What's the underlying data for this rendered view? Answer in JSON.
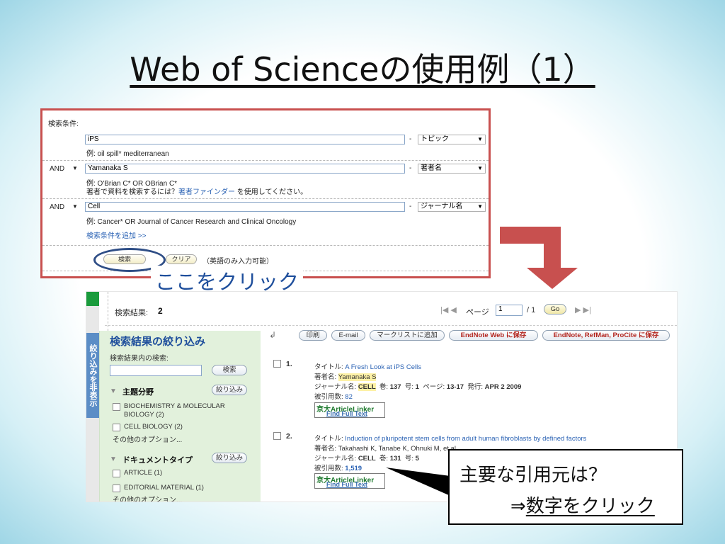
{
  "slide": {
    "title": "Web of Scienceの使用例（1）",
    "click_here": "ここをクリック",
    "callout_line1": "主要な引用元は？",
    "callout_arrow": "⇒",
    "callout_line2": "数字をクリック"
  },
  "search_form": {
    "header": "検索条件:",
    "rows": [
      {
        "op": "",
        "value": "iPS",
        "example": "例: oil spill* mediterranean",
        "field": "トピック"
      },
      {
        "op": "AND",
        "value": "Yamanaka S",
        "example": "例: O'Brian C* OR OBrian C*",
        "field": "著者名",
        "hint_pre": "著者で資料を検索するには？",
        "hint_link": "著者ファインダー",
        "hint_post": " を使用してください。"
      },
      {
        "op": "AND",
        "value": "Cell",
        "example": "例: Cancer* OR Journal of Cancer Research and Clinical Oncology",
        "field": "ジャーナル名"
      }
    ],
    "add_link": "検索条件を追加 >>",
    "search_btn": "検索",
    "clear_btn": "クリア",
    "english_note": "（英語のみ入力可能）",
    "dash": "-"
  },
  "results": {
    "count_label": "検索結果:",
    "count": "2",
    "page_label": "ページ",
    "page_value": "1",
    "page_total": "/ 1",
    "go_btn": "Go",
    "prev_icons": "|◀ ◀",
    "next_icons": "▶ ▶|",
    "toolbar": [
      "印刷",
      "E-mail",
      "マークリストに追加",
      "EndNote Web に保存",
      "EndNote, RefMan, ProCite に保存"
    ],
    "sidebar_tab": "絞り込みを非表示",
    "sidebar": {
      "title": "検索結果の絞り込み",
      "within_label": "検索結果内の検索:",
      "within_btn": "検索",
      "section1": "主題分野",
      "section1_btn": "絞り込み",
      "s1_items": [
        "BIOCHEMISTRY & MOLECULAR",
        "BIOLOGY (2)",
        "CELL BIOLOGY (2)"
      ],
      "more1": "その他のオプション...",
      "section2": "ドキュメントタイプ",
      "section2_btn": "絞り込み",
      "s2_items": [
        "ARTICLE (1)",
        "EDITORIAL MATERIAL (1)"
      ],
      "more2": "その他のオプション..."
    },
    "items": [
      {
        "num": "1.",
        "title_label": "タイトル:",
        "title": "A Fresh Look at iPS Cells",
        "author_label": "著者名:",
        "authors": "Yamanaka S",
        "journal_label": "ジャーナル名:",
        "journal": "CELL",
        "vol_label": "巻:",
        "vol": "137",
        "issue_label": "号:",
        "issue": "1",
        "page_label": "ページ:",
        "pages": "13-17",
        "pub_label": "発行:",
        "pub": "APR 2 2009",
        "cited_label": "被引用数:",
        "cited": "82"
      },
      {
        "num": "2.",
        "title_label": "タイトル:",
        "title": "Induction of pluripotent stem cells from adult human fibroblasts by defined factors",
        "author_label": "著者名:",
        "authors": "Takahashi K, Tanabe K, Ohnuki M, et al.",
        "journal_label": "ジャーナル名:",
        "journal": "CELL",
        "vol_label": "巻:",
        "vol": "131",
        "issue_label": "号:",
        "issue": "5",
        "cited_label": "被引用数:",
        "cited": "1,519"
      }
    ],
    "article_linker_1": "京大ArticleLinker",
    "article_linker_2": "Find Full Text"
  }
}
